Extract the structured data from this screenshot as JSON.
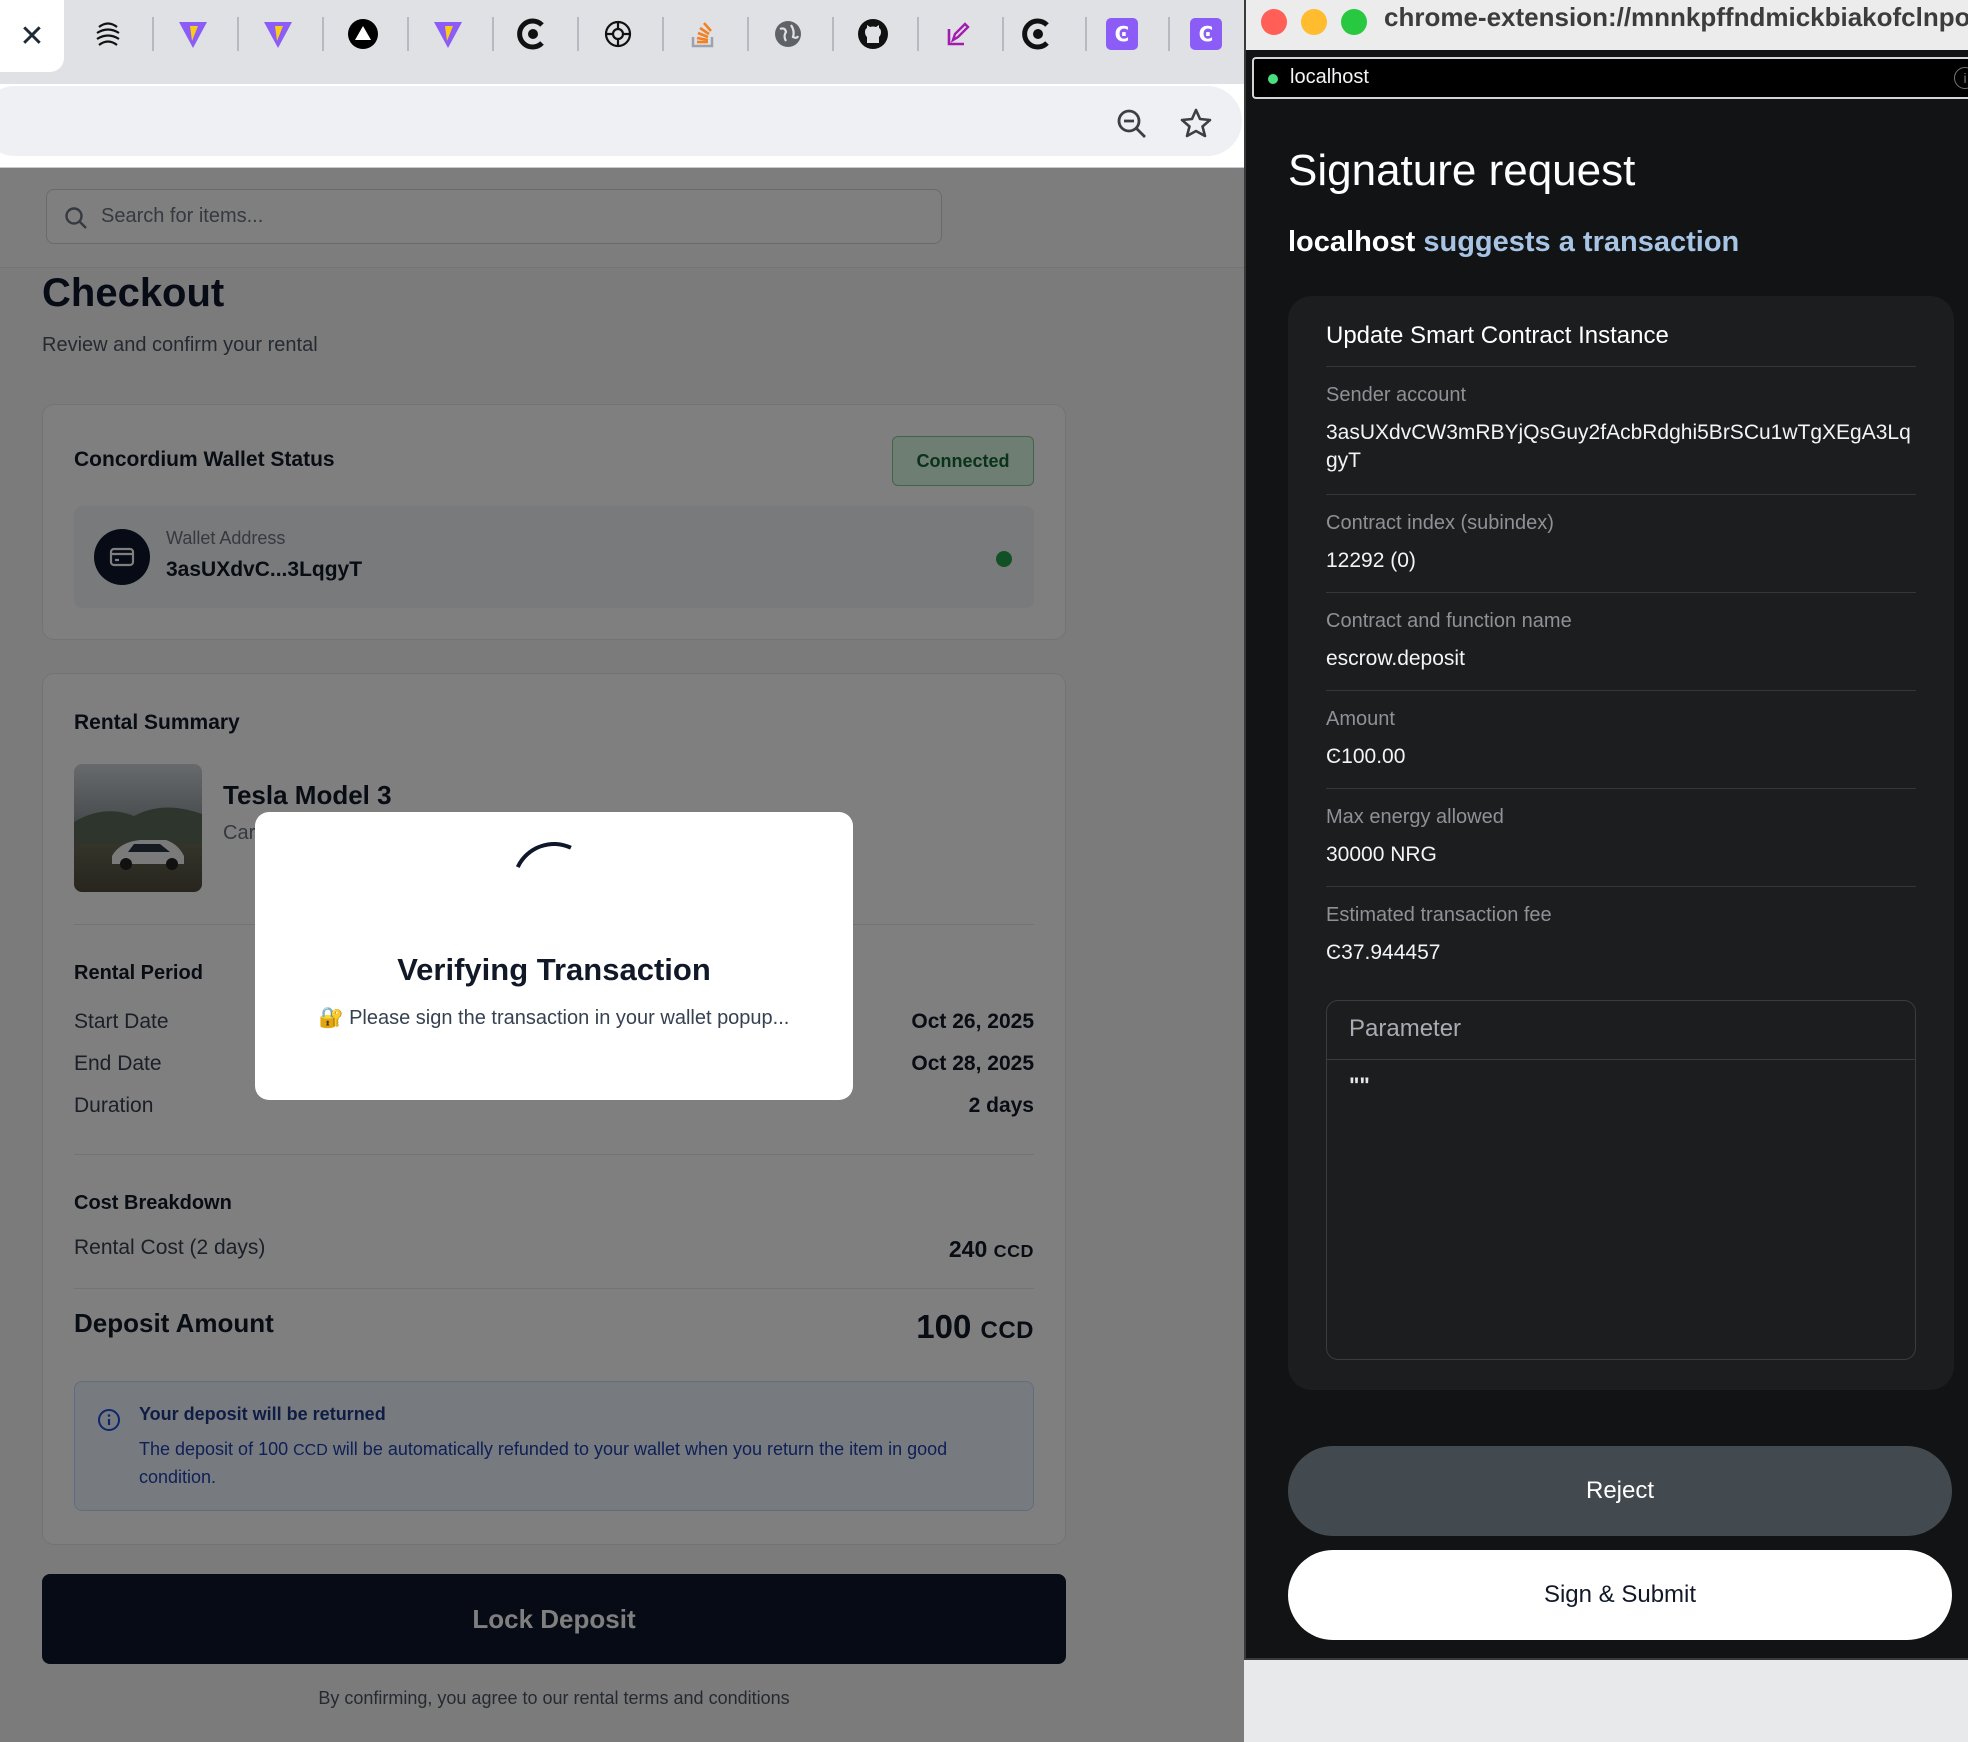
{
  "browser": {
    "close_tab_glyph": "✕",
    "pinned_tabs": [
      {
        "icon": "openai-icon"
      },
      {
        "icon": "vite-icon"
      },
      {
        "icon": "vite-icon"
      },
      {
        "icon": "triangle-logo-icon"
      },
      {
        "icon": "vite-icon"
      },
      {
        "icon": "ring-logo-icon"
      },
      {
        "icon": "chatgpt-icon"
      },
      {
        "icon": "stackoverflow-icon"
      },
      {
        "icon": "globe-icon"
      },
      {
        "icon": "github-icon"
      },
      {
        "icon": "sparkle-edit-icon"
      },
      {
        "icon": "ring-logo-icon"
      },
      {
        "icon": "concordium-icon"
      },
      {
        "icon": "concordium-icon"
      }
    ],
    "toolbar_icons": [
      "zoom-out-icon",
      "bookmark-star-icon"
    ]
  },
  "page": {
    "search_placeholder": "Search for items...",
    "title": "Checkout",
    "subtitle": "Review and confirm your rental",
    "wallet": {
      "title": "Concordium Wallet Status",
      "status": "Connected",
      "address_label": "Wallet Address",
      "address": "3asUXdvC...3LqgyT",
      "status_color": "#22a34a"
    },
    "rental": {
      "title": "Rental Summary",
      "item_name": "Tesla Model 3",
      "item_category_visible": "Car",
      "period_title": "Rental Period",
      "start_label": "Start Date",
      "start_value": "Oct 26, 2025",
      "end_label": "End Date",
      "end_value": "Oct 28, 2025",
      "duration_label": "Duration",
      "duration_value": "2 days",
      "cost_title": "Cost Breakdown",
      "rental_cost_label": "Rental Cost (2 days)",
      "rental_cost_value": "240",
      "currency": "CCD",
      "deposit_label": "Deposit Amount",
      "deposit_value": "100"
    },
    "info": {
      "title": "Your deposit will be returned",
      "text_before": "The deposit of 100",
      "currency": "CCD",
      "text_after": "will be automatically refunded to your wallet when you return the item in good condition."
    },
    "lock_button": "Lock Deposit",
    "terms": "By confirming, you agree to our rental terms and conditions"
  },
  "modal": {
    "title": "Verifying Transaction",
    "message": "🔐 Please sign the transaction in your wallet popup..."
  },
  "popup": {
    "window_url": "chrome-extension://mnnkpffndmickbiakofclnpoiajlegmg/popup.html",
    "url_host": "localhost",
    "info_glyph": "i",
    "title": "Signature request",
    "subtitle_host": "localhost",
    "subtitle_rest": "suggests a transaction",
    "details_title": "Update Smart Contract Instance",
    "fields": [
      {
        "label": "Sender account",
        "value": "3asUXdvCW3mRBYjQsGuy2fAcbRdghi5BrSCu1wTgXEgA3LqgyT"
      },
      {
        "label": "Contract index (subindex)",
        "value": "12292 (0)"
      },
      {
        "label": "Contract and function name",
        "value": "escrow.deposit"
      },
      {
        "label": "Amount",
        "value": "Ͼ100.00"
      },
      {
        "label": "Max energy allowed",
        "value": "30000 NRG"
      },
      {
        "label": "Estimated transaction fee",
        "value": "Ͼ37.944457"
      }
    ],
    "parameter_label": "Parameter",
    "parameter_value": "\"\"",
    "reject_button": "Reject",
    "sign_button": "Sign & Submit"
  }
}
